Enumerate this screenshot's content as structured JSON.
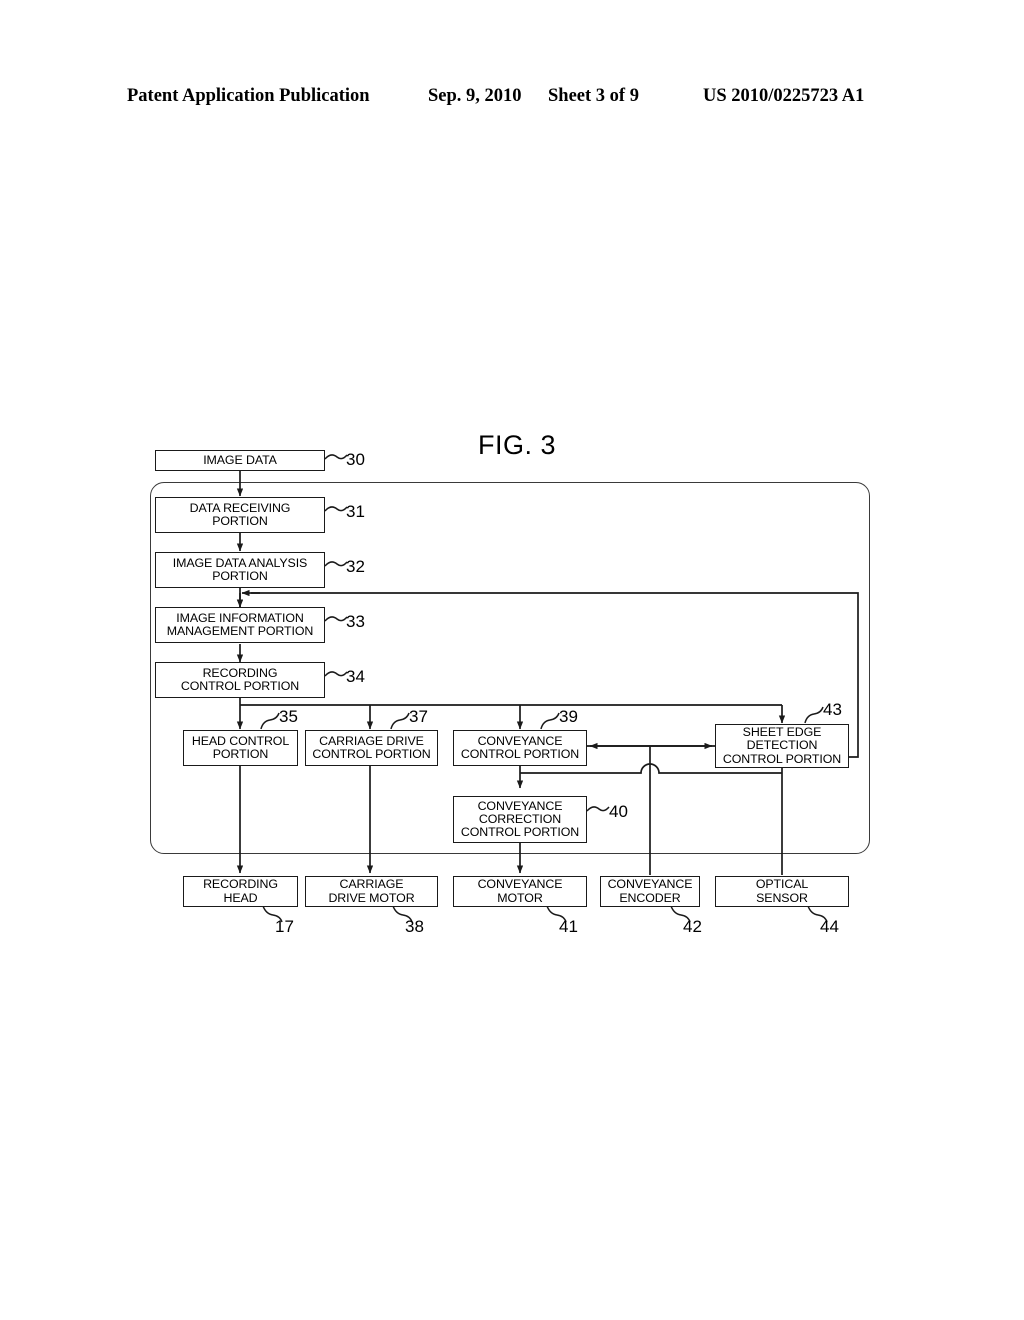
{
  "header": {
    "publication": "Patent Application Publication",
    "date": "Sep. 9, 2010",
    "sheet": "Sheet 3 of 9",
    "patent_number": "US 2010/0225723 A1"
  },
  "figure": {
    "title": "FIG. 3",
    "type": "block-diagram",
    "blocks": [
      {
        "id": "30",
        "label": "IMAGE DATA",
        "ref": "30"
      },
      {
        "id": "31",
        "label": "DATA RECEIVING\nPORTION",
        "ref": "31"
      },
      {
        "id": "32",
        "label": "IMAGE DATA ANALYSIS\nPORTION",
        "ref": "32"
      },
      {
        "id": "33",
        "label": "IMAGE INFORMATION\nMANAGEMENT PORTION",
        "ref": "33"
      },
      {
        "id": "34",
        "label": "RECORDING\nCONTROL PORTION",
        "ref": "34"
      },
      {
        "id": "35",
        "label": "HEAD CONTROL\nPORTION",
        "ref": "35"
      },
      {
        "id": "37",
        "label": "CARRIAGE DRIVE\nCONTROL PORTION",
        "ref": "37"
      },
      {
        "id": "39",
        "label": "CONVEYANCE\nCONTROL PORTION",
        "ref": "39"
      },
      {
        "id": "43",
        "label": "SHEET EDGE\nDETECTION\nCONTROL PORTION",
        "ref": "43"
      },
      {
        "id": "40",
        "label": "CONVEYANCE\nCORRECTION\nCONTROL PORTION",
        "ref": "40"
      },
      {
        "id": "17",
        "label": "RECORDING\nHEAD",
        "ref": "17"
      },
      {
        "id": "38",
        "label": "CARRIAGE\nDRIVE MOTOR",
        "ref": "38"
      },
      {
        "id": "41",
        "label": "CONVEYANCE\nMOTOR",
        "ref": "41"
      },
      {
        "id": "42",
        "label": "CONVEYANCE\nENCODER",
        "ref": "42"
      },
      {
        "id": "44",
        "label": "OPTICAL\nSENSOR",
        "ref": "44"
      }
    ],
    "line_color": "#1a1a1a"
  }
}
